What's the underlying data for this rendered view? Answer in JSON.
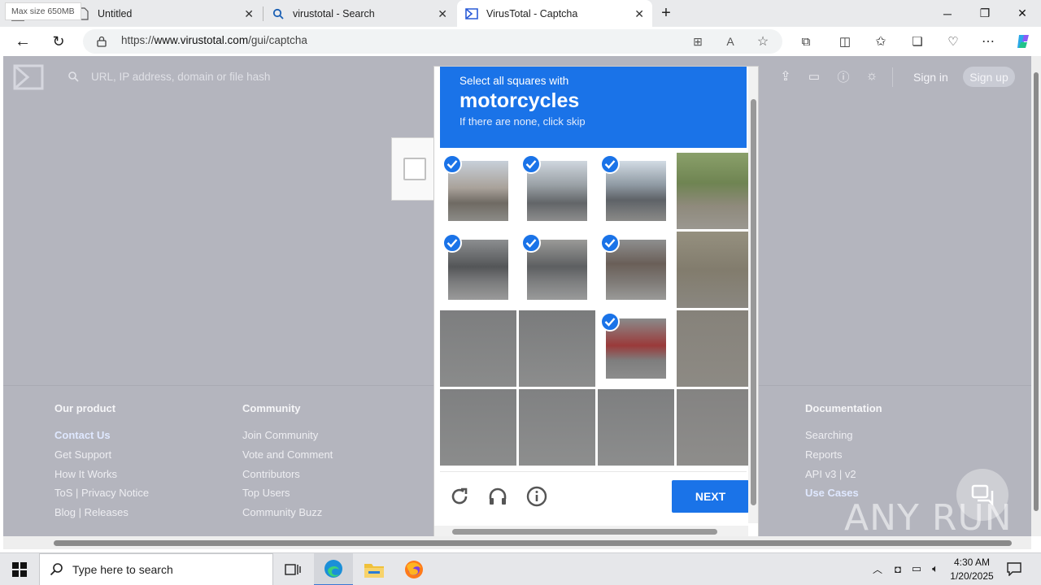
{
  "tabs": [
    {
      "title": "Untitled"
    },
    {
      "title": "virustotal - Search"
    },
    {
      "title": "VirusTotal - Captcha"
    }
  ],
  "address": {
    "scheme": "https://",
    "host": "www.virustotal.com",
    "path": "/gui/captcha"
  },
  "vt": {
    "max_size": "Max size 650MB",
    "search_placeholder": "URL, IP address, domain or file hash",
    "sign_in": "Sign in",
    "sign_up": "Sign up"
  },
  "footer": {
    "our_product": {
      "heading": "Our product",
      "links": [
        "Contact Us",
        "Get Support",
        "How It Works",
        "ToS | Privacy Notice",
        "Blog | Releases"
      ]
    },
    "community": {
      "heading": "Community",
      "links": [
        "Join Community",
        "Vote and Comment",
        "Contributors",
        "Top Users",
        "Community Buzz"
      ]
    },
    "documentation": {
      "heading": "Documentation",
      "links": [
        "Searching",
        "Reports",
        "API v3 | v2",
        "Use Cases"
      ]
    }
  },
  "captcha": {
    "instruction": "Select all squares with",
    "target": "motorcycles",
    "hint": "If there are none, click skip",
    "next_label": "NEXT",
    "selected_tiles": [
      0,
      1,
      2,
      4,
      5,
      6,
      10
    ]
  },
  "taskbar": {
    "search_placeholder": "Type here to search",
    "time": "4:30 AM",
    "date": "1/20/2025"
  },
  "watermark": "ANY RUN",
  "colors": {
    "accent": "#1a73e8",
    "vt_bg": "#b4b5be"
  }
}
